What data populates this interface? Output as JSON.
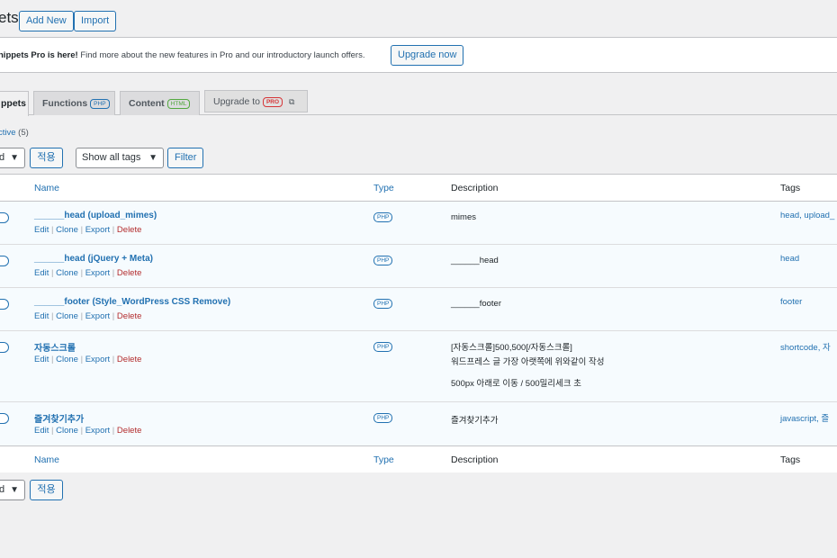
{
  "header": {
    "title": "ets",
    "add_new": "Add New",
    "import": "Import"
  },
  "notice": {
    "bold": "nippets Pro is here!",
    "text": " Find more about the new features in Pro and our introductory launch offers.",
    "button": "Upgrade now"
  },
  "tabs": [
    {
      "label": "ppets",
      "badge": ""
    },
    {
      "label": "Functions",
      "badge": "PHP"
    },
    {
      "label": "Content",
      "badge": "HTML"
    },
    {
      "label": "Upgrade to",
      "badge": "PRO"
    }
  ],
  "filter": {
    "label": "ctive",
    "count": " (5)"
  },
  "bulk_top": {
    "selected": "d",
    "apply": "적용"
  },
  "tag_select": {
    "selected": "Show all tags",
    "filter": "Filter"
  },
  "columns": {
    "name": "Name",
    "type": "Type",
    "description": "Description",
    "tags": "Tags"
  },
  "row_actions": {
    "edit": "Edit",
    "clone": "Clone",
    "export": "Export",
    "delete": "Delete",
    "sep": " | "
  },
  "rows": [
    {
      "name": "______head (upload_mimes)",
      "type": "PHP",
      "description": "mimes",
      "description2": "",
      "description3": "",
      "tags": "head, upload_"
    },
    {
      "name": "______head (jQuery + Meta)",
      "type": "PHP",
      "description": "______head",
      "description2": "",
      "description3": "",
      "tags": "head"
    },
    {
      "name": "______footer (Style_WordPress CSS Remove)",
      "type": "PHP",
      "description": "______footer",
      "description2": "",
      "description3": "",
      "tags": "footer"
    },
    {
      "name": "자동스크롤",
      "type": "PHP",
      "description": "[자동스크롤]500,500[/자동스크롤]",
      "description2": "워드프레스 글 가장 아랫쪽에 위와같이 작성",
      "description3": "500px 아래로 이동 / 500밀리세크 초",
      "tags": "shortcode, 자"
    },
    {
      "name": "즐겨찾기추가",
      "type": "PHP",
      "description": "즐겨찾기추가",
      "description2": "",
      "description3": "",
      "tags": "javascript, 즐"
    }
  ],
  "bulk_bottom": {
    "selected": "d",
    "apply": "적용"
  }
}
